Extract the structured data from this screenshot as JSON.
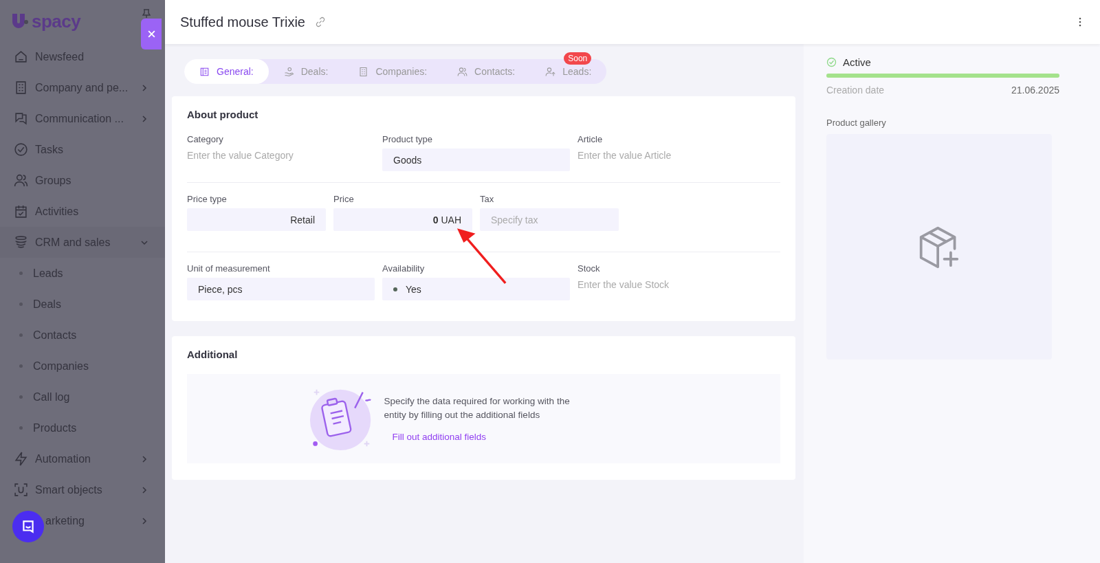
{
  "sidebar": {
    "logo_text": "spacy",
    "items": [
      {
        "label": "Newsfeed"
      },
      {
        "label": "Company and pe...",
        "expanded": false
      },
      {
        "label": "Communication ...",
        "expanded": false
      },
      {
        "label": "Tasks"
      },
      {
        "label": "Groups"
      },
      {
        "label": "Activities"
      },
      {
        "label": "CRM and sales",
        "expanded": true,
        "children": [
          {
            "label": "Leads"
          },
          {
            "label": "Deals"
          },
          {
            "label": "Contacts"
          },
          {
            "label": "Companies"
          },
          {
            "label": "Call log"
          },
          {
            "label": "Products"
          }
        ]
      },
      {
        "label": "Automation",
        "expanded": false
      },
      {
        "label": "Smart objects",
        "expanded": false
      },
      {
        "label": "arketing",
        "expanded": false
      }
    ]
  },
  "header": {
    "title": "Stuffed mouse Trixie"
  },
  "tabs": [
    {
      "label": "General:",
      "selected": true
    },
    {
      "label": "Deals:",
      "selected": false
    },
    {
      "label": "Companies:",
      "selected": false
    },
    {
      "label": "Contacts:",
      "selected": false
    },
    {
      "label": "Leads:",
      "selected": false,
      "badge": "Soon"
    }
  ],
  "about": {
    "title": "About product",
    "rows": [
      {
        "fields": [
          {
            "label": "Category",
            "kind": "plain",
            "placeholder": "Enter the value Category"
          },
          {
            "label": "Product type",
            "kind": "box",
            "value": "Goods"
          },
          {
            "label": "Article",
            "kind": "plain",
            "placeholder": "Enter the value Article"
          }
        ]
      },
      {
        "fields": [
          {
            "label": "Price type",
            "kind": "box",
            "value": "Retail"
          },
          {
            "label": "Price",
            "kind": "box",
            "value": "**0** UAH"
          },
          {
            "label": "Tax",
            "kind": "box",
            "placeholder": "Specify tax"
          }
        ]
      },
      {
        "fields": [
          {
            "label": "Unit of measurement",
            "kind": "box",
            "value": "Piece, pcs"
          },
          {
            "label": "Availability",
            "kind": "box",
            "value": "Yes",
            "color": "#55665a"
          },
          {
            "label": "Stock",
            "kind": "plain",
            "placeholder": "Enter the value Stock"
          }
        ]
      }
    ]
  },
  "additional": {
    "title": "Additional",
    "text": "Specify the data required for working with the entity by filling out the additional fields",
    "link": "Fill out additional fields"
  },
  "side_panel": {
    "status": "Active",
    "level": 1,
    "creation_label": "Creation date",
    "creation_date": "21.06.2025",
    "gallery_label": "Product gallery"
  }
}
